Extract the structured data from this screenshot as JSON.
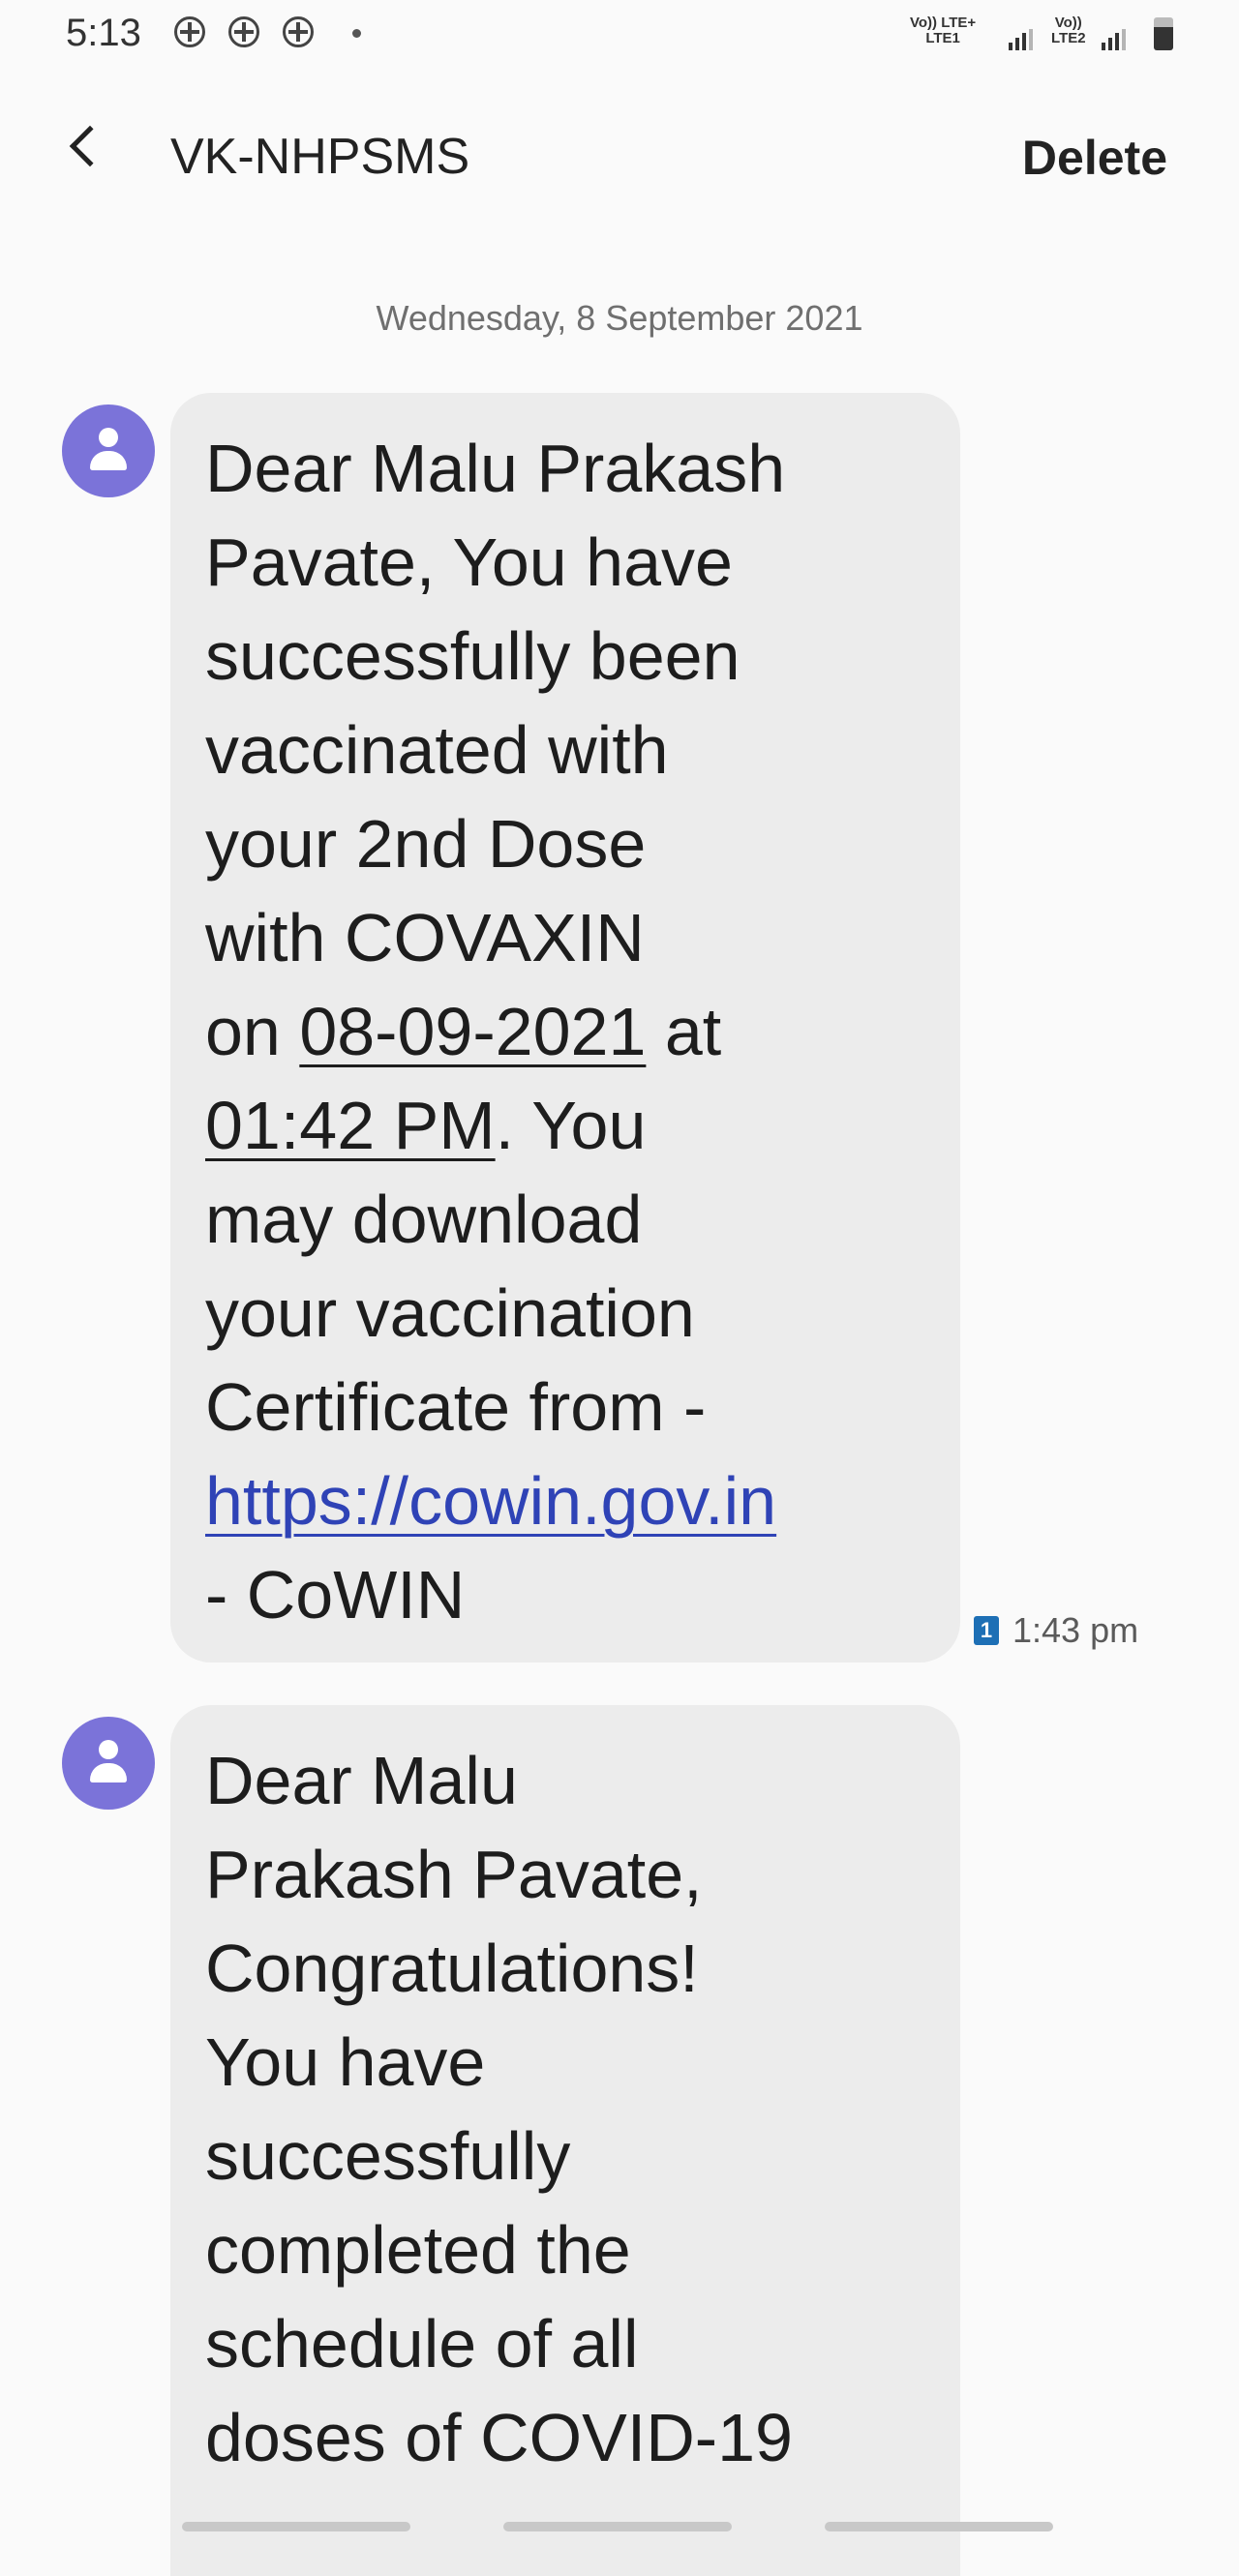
{
  "status_bar": {
    "time": "5:13",
    "notification_icons": [
      "cross-circle-icon",
      "cross-circle-icon",
      "cross-circle-icon"
    ],
    "sim1_label_top": "Vo)) LTE+",
    "sim1_label_bottom": "LTE1",
    "sim2_label_top": "Vo))",
    "sim2_label_bottom": "LTE2"
  },
  "header": {
    "title": "VK-NHPSMS",
    "delete_label": "Delete"
  },
  "conversation": {
    "date_separator": "Wednesday, 8 September 2021",
    "messages": [
      {
        "lines": [
          "Dear Malu Prakash",
          "Pavate, You have",
          "successfully been",
          "vaccinated with",
          "your 2nd Dose",
          "with COVAXIN"
        ],
        "on_prefix": "on ",
        "date": "08-09-2021",
        "at_text": " at",
        "time": "01:42 PM",
        "time_suffix": ". You",
        "lines_after": [
          "may download",
          "your vaccination",
          "Certificate from -"
        ],
        "link": "https://cowin.gov.in",
        "signature": "- CoWIN",
        "sim_badge": "1",
        "timestamp": "1:43 pm"
      },
      {
        "lines": [
          "Dear Malu",
          "Prakash Pavate,",
          "Congratulations!",
          "You have",
          "successfully",
          "completed the",
          "schedule of all",
          "doses of COVID-19"
        ]
      }
    ]
  },
  "colors": {
    "avatar": "#7b73d9",
    "bubble": "#ececec",
    "link": "#2f43b6",
    "sim_badge": "#1d6fb5"
  }
}
